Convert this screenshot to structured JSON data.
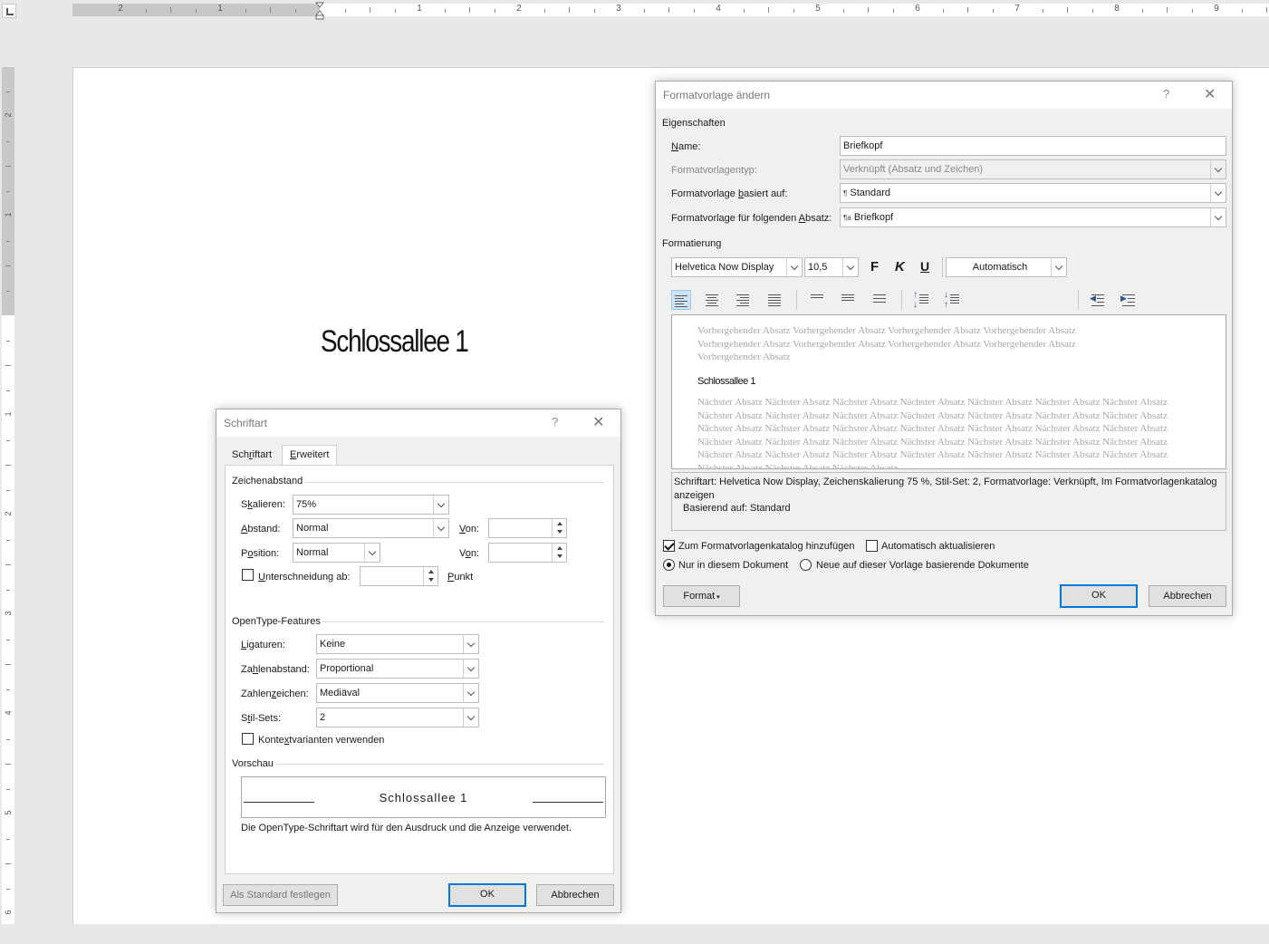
{
  "ruler": {
    "h_numbers": [
      "2",
      "1",
      "1",
      "2",
      "3",
      "4",
      "5",
      "6",
      "7",
      "8",
      "9"
    ],
    "v_numbers": [
      "2",
      "1",
      "1",
      "2",
      "3",
      "4",
      "5",
      "6"
    ]
  },
  "document": {
    "heading": "Schlossallee 1"
  },
  "schriftart": {
    "title": "Schriftart",
    "tabs": [
      "Schriftart",
      "Erweitert"
    ],
    "section_spacing": "Zeichenabstand",
    "skalieren_label": "Skalieren:",
    "skalieren_value": "75%",
    "abstand_label": "Abstand:",
    "abstand_value": "Normal",
    "abstand_von_label": "Von:",
    "position_label": "Position:",
    "position_value": "Normal",
    "position_von_label": "Von:",
    "kerning_label": "Unterschneidung ab:",
    "kerning_unit": "Punkt",
    "section_opentype": "OpenType-Features",
    "ligaturen_label": "Ligaturen:",
    "ligaturen_value": "Keine",
    "zahlenabstand_label": "Zahlenabstand:",
    "zahlenabstand_value": "Proportional",
    "zahlenzeichen_label": "Zahlenzeichen:",
    "zahlenzeichen_value": "Mediäval",
    "stilsets_label": "Stil-Sets:",
    "stilsets_value": "2",
    "kontext_label": "Kontextvarianten verwenden",
    "section_preview": "Vorschau",
    "preview_text": "Schlossallee 1",
    "preview_note": "Die OpenType-Schriftart wird für den Ausdruck und die Anzeige verwendet.",
    "btn_default": "Als Standard festlegen",
    "btn_ok": "OK",
    "btn_cancel": "Abbrechen"
  },
  "formatvorlage": {
    "title": "Formatvorlage ändern",
    "section_props": "Eigenschaften",
    "name_label": "Name:",
    "name_value": "Briefkopf",
    "type_label": "Formatvorlagentyp:",
    "type_value": "Verknüpft (Absatz und Zeichen)",
    "based_label": "Formatvorlage basiert auf:",
    "based_value": "Standard",
    "next_label": "Formatvorlage für folgenden Absatz:",
    "next_value": "Briefkopf",
    "section_format": "Formatierung",
    "font_value": "Helvetica Now Display",
    "size_value": "10,5",
    "bold_label": "F",
    "italic_label": "K",
    "underline_label": "U",
    "color_value": "Automatisch",
    "preview_prev": "Vorhergehender Absatz Vorhergehender Absatz Vorhergehender Absatz Vorhergehender Absatz Vorhergehender Absatz Vorhergehender Absatz Vorhergehender Absatz Vorhergehender Absatz Vorhergehender Absatz",
    "preview_sample": "Schlossallee 1",
    "preview_next": "Nächster Absatz Nächster Absatz Nächster Absatz Nächster Absatz Nächster Absatz Nächster Absatz Nächster Absatz Nächster Absatz Nächster Absatz Nächster Absatz Nächster Absatz Nächster Absatz Nächster Absatz Nächster Absatz Nächster Absatz Nächster Absatz Nächster Absatz Nächster Absatz Nächster Absatz Nächster Absatz Nächster Absatz Nächster Absatz Nächster Absatz Nächster Absatz Nächster Absatz Nächster Absatz Nächster Absatz Nächster Absatz Nächster Absatz Nächster Absatz Nächster Absatz Nächster Absatz Nächster Absatz Nächster Absatz Nächster Absatz Nächster Absatz Nächster Absatz Nächster Absatz",
    "description": "Schriftart: Helvetica Now Display, Zeichenskalierung 75 %, Stil-Set: 2, Formatvorlage: Verknüpft, Im Formatvorlagenkatalog anzeigen",
    "description_based": "Basierend auf: Standard",
    "add_gallery_label": "Zum Formatvorlagenkatalog hinzufügen",
    "auto_update_label": "Automatisch aktualisieren",
    "only_doc_label": "Nur in diesem Dokument",
    "new_docs_label": "Neue auf dieser Vorlage basierende Dokumente",
    "btn_format": "Format",
    "btn_ok": "OK",
    "btn_cancel": "Abbrechen"
  }
}
